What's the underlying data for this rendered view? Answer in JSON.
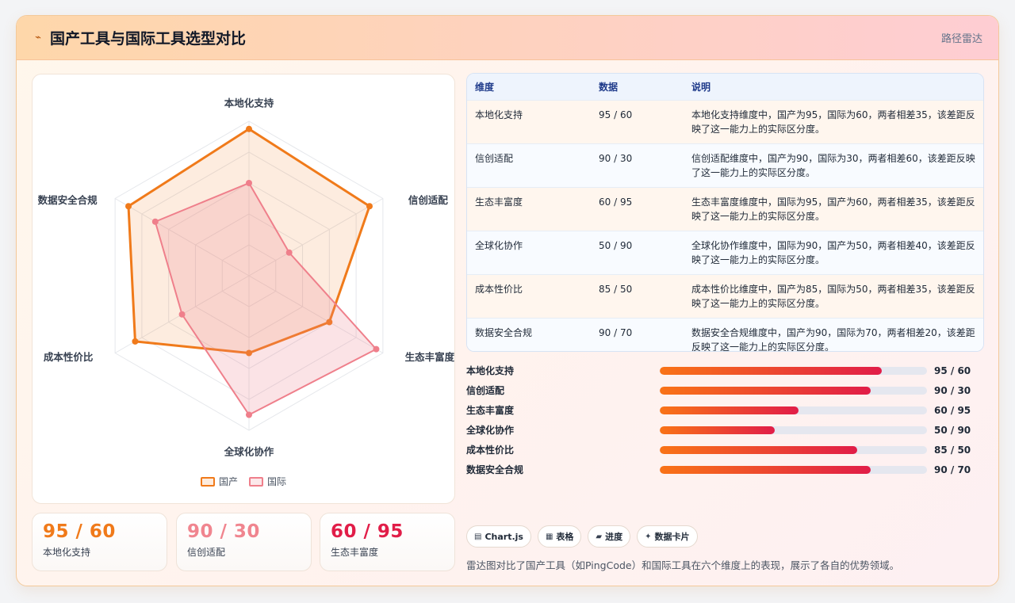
{
  "header": {
    "icon": "chart-line-icon",
    "title": "国产工具与国际工具选型对比",
    "subtitle": "路径雷达"
  },
  "colors": {
    "domestic": "#f07a1a",
    "international": "#ef7f8b",
    "accent_red": "#e11d48"
  },
  "chart_data": {
    "type": "radar",
    "axes": [
      "本地化支持",
      "信创适配",
      "生态丰富度",
      "全球化协作",
      "成本性价比",
      "数据安全合规"
    ],
    "range": [
      0,
      100
    ],
    "series": [
      {
        "name": "国产",
        "values": [
          95,
          90,
          60,
          50,
          85,
          90
        ]
      },
      {
        "name": "国际",
        "values": [
          60,
          30,
          95,
          90,
          50,
          70
        ]
      }
    ],
    "legend_position": "bottom"
  },
  "stats": [
    {
      "value": "95 / 60",
      "label": "本地化支持",
      "color": "#f07a1a"
    },
    {
      "value": "90 / 30",
      "label": "信创适配",
      "color": "#f0858f"
    },
    {
      "value": "60 / 95",
      "label": "生态丰富度",
      "color": "#e11d48"
    }
  ],
  "table": {
    "headers": [
      "维度",
      "数据",
      "说明"
    ],
    "rows": [
      {
        "dim": "本地化支持",
        "val": "95 / 60",
        "desc": "本地化支持维度中，国产为95，国际为60，两者相差35，该差距反映了这一能力上的实际区分度。"
      },
      {
        "dim": "信创适配",
        "val": "90 / 30",
        "desc": "信创适配维度中，国产为90，国际为30，两者相差60，该差距反映了这一能力上的实际区分度。"
      },
      {
        "dim": "生态丰富度",
        "val": "60 / 95",
        "desc": "生态丰富度维度中，国际为95，国产为60，两者相差35，该差距反映了这一能力上的实际区分度。"
      },
      {
        "dim": "全球化协作",
        "val": "50 / 90",
        "desc": "全球化协作维度中，国际为90，国产为50，两者相差40，该差距反映了这一能力上的实际区分度。"
      },
      {
        "dim": "成本性价比",
        "val": "85 / 50",
        "desc": "成本性价比维度中，国产为85，国际为50，两者相差35，该差距反映了这一能力上的实际区分度。"
      },
      {
        "dim": "数据安全合规",
        "val": "90 / 70",
        "desc": "数据安全合规维度中，国产为90，国际为70，两者相差20，该差距反映了这一能力上的实际区分度。"
      }
    ]
  },
  "bars": [
    {
      "name": "本地化支持",
      "val": "95 / 60",
      "fill": 0.83
    },
    {
      "name": "信创适配",
      "val": "90 / 30",
      "fill": 0.79
    },
    {
      "name": "生态丰富度",
      "val": "60 / 95",
      "fill": 0.52
    },
    {
      "name": "全球化协作",
      "val": "50 / 90",
      "fill": 0.43
    },
    {
      "name": "成本性价比",
      "val": "85 / 50",
      "fill": 0.74
    },
    {
      "name": "数据安全合规",
      "val": "90 / 70",
      "fill": 0.79
    }
  ],
  "tags": [
    {
      "icon": "chart-icon",
      "glyph": "▤",
      "label": "Chart.js"
    },
    {
      "icon": "table-icon",
      "glyph": "▦",
      "label": "表格"
    },
    {
      "icon": "progress-icon",
      "glyph": "▰",
      "label": "进度"
    },
    {
      "icon": "sparkle-icon",
      "glyph": "✦",
      "label": "数据卡片"
    }
  ],
  "footnote": "雷达图对比了国产工具（如PingCode）和国际工具在六个维度上的表现，展示了各自的优势领域。"
}
